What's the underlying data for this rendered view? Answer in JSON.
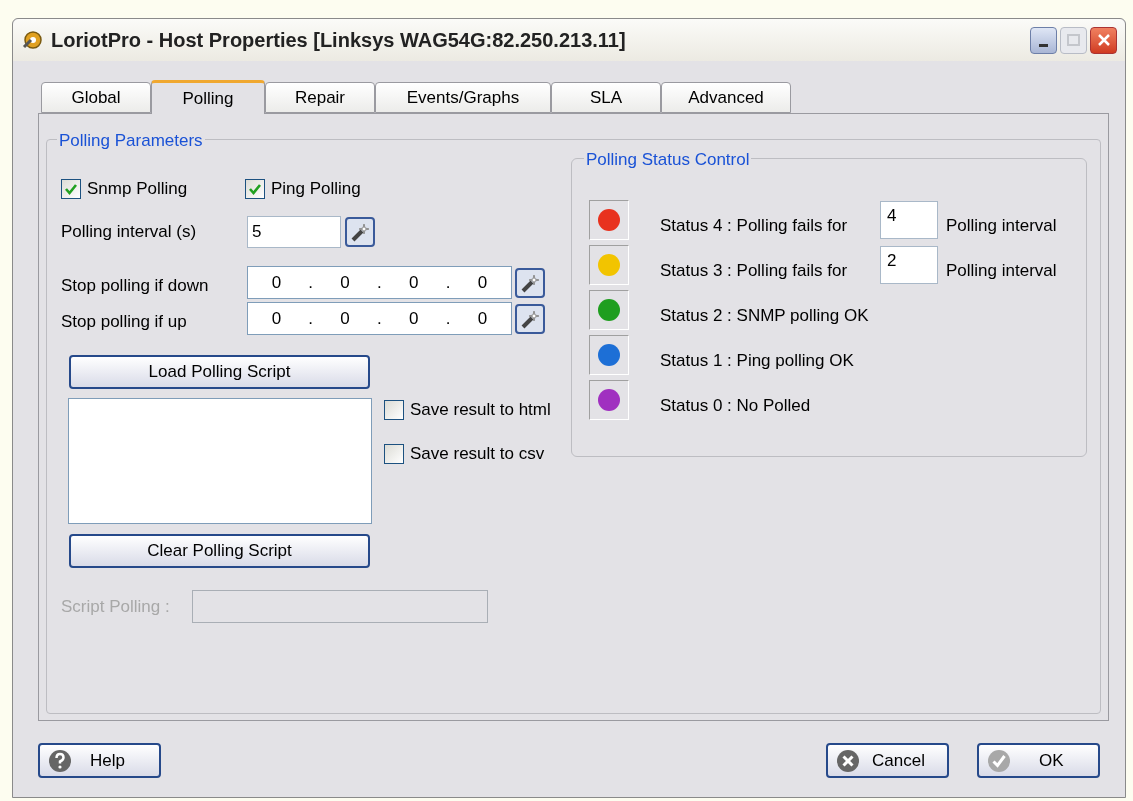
{
  "window": {
    "title": "LoriotPro - Host Properties [Linksys WAG54G:82.250.213.11]"
  },
  "tabs": [
    {
      "label": "Global",
      "selected": false
    },
    {
      "label": "Polling",
      "selected": true
    },
    {
      "label": "Repair",
      "selected": false
    },
    {
      "label": "Events/Graphs",
      "selected": false
    },
    {
      "label": "SLA",
      "selected": false
    },
    {
      "label": "Advanced",
      "selected": false
    }
  ],
  "polling_parameters": {
    "title": "Polling Parameters",
    "checkboxes": [
      {
        "label": "Snmp Polling",
        "checked": true
      },
      {
        "label": "Ping Polling",
        "checked": true
      }
    ],
    "polling_interval": {
      "label": "Polling interval (s)",
      "value": "5"
    },
    "ip_fields": [
      {
        "label": "Stop polling if down",
        "octets": [
          "0",
          "0",
          "0",
          "0"
        ],
        "separators": [
          ".",
          ".",
          "."
        ]
      },
      {
        "label": "Stop polling if up",
        "octets": [
          "0",
          "0",
          "0",
          "0"
        ],
        "separators": [
          ".",
          ".",
          "."
        ]
      }
    ],
    "load_button": "Load Polling Script",
    "save_options": [
      {
        "label": "Save result to html",
        "checked": false
      },
      {
        "label": "Save result to csv",
        "checked": false
      }
    ],
    "clear_button": "Clear Polling Script",
    "script_polling": {
      "label": "Script Polling :",
      "disabled": true
    }
  },
  "status_control": {
    "title": "Polling Status Control",
    "statuses": [
      {
        "kind": "threshold",
        "label": "Status 4 : Polling fails for",
        "value": "4",
        "suffix": "Polling interval",
        "color": "#e8321e"
      },
      {
        "kind": "threshold",
        "label": "Status 3 : Polling fails for",
        "value": "2",
        "suffix": "Polling interval",
        "color": "#f2c400"
      },
      {
        "kind": "plain",
        "label": "Status 2 : SNMP polling OK",
        "color": "#1f9e1f"
      },
      {
        "kind": "plain",
        "label": "Status 1 : Ping polling OK",
        "color": "#1d6fd6"
      },
      {
        "kind": "plain",
        "label": "Status 0 : No Polled",
        "color": "#a030c0"
      }
    ]
  },
  "buttons": {
    "help": "Help",
    "cancel": "Cancel",
    "ok": "OK"
  }
}
